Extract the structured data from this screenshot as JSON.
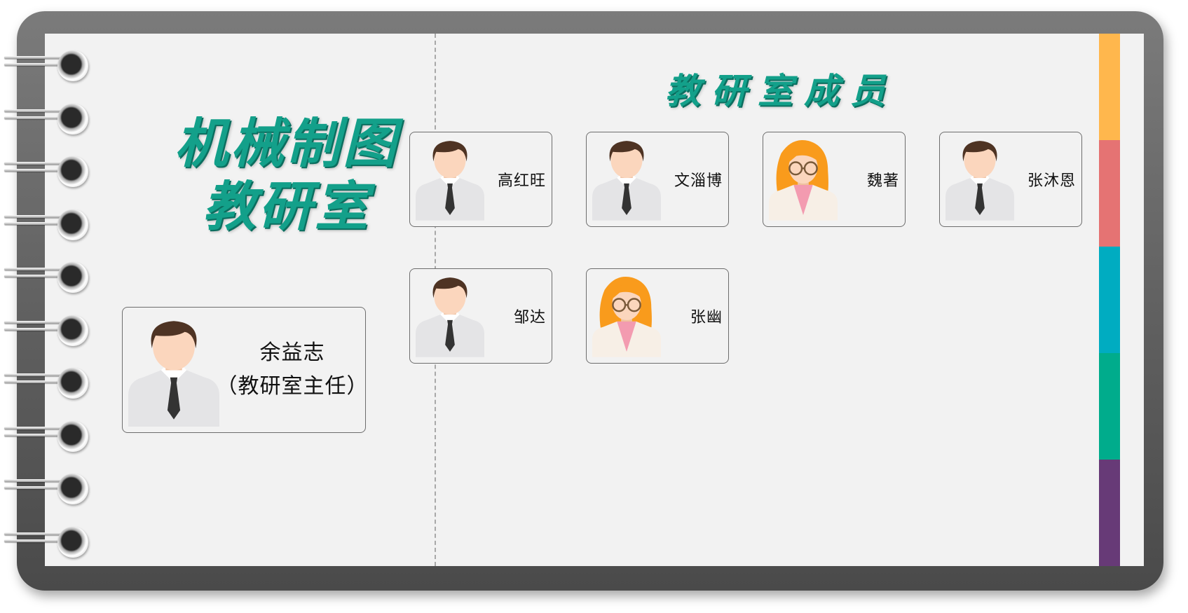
{
  "colors": {
    "title_green": "#13a08a",
    "tab_colors": [
      "#ffb74d",
      "#e57373",
      "#00acc1",
      "#00ac8c",
      "#673a77"
    ]
  },
  "department": {
    "title_line1": "机械制图",
    "title_line2": "教研室"
  },
  "head": {
    "name": "余益志",
    "role": "（教研室主任）",
    "avatar": "male-avatar-icon"
  },
  "members_title": "教研室成员",
  "members": [
    {
      "name": "高红旺",
      "avatar": "male-avatar-icon"
    },
    {
      "name": "文淄博",
      "avatar": "male-avatar-icon"
    },
    {
      "name": "魏著",
      "avatar": "female-avatar-icon"
    },
    {
      "name": "张沐恩",
      "avatar": "male-avatar-icon"
    },
    {
      "name": "邹达",
      "avatar": "male-avatar-icon"
    },
    {
      "name": "张幽",
      "avatar": "female-avatar-icon"
    }
  ]
}
